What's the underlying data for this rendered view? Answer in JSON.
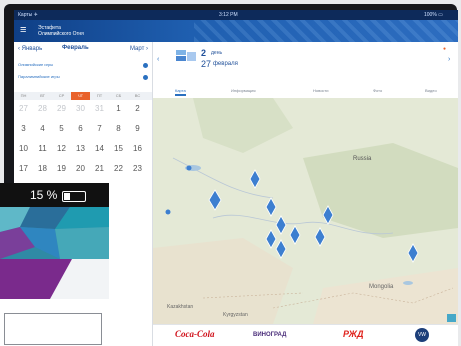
{
  "statusbar": {
    "carrier": "Карты ✈",
    "time": "3:12 PM",
    "battery": "100% ▭"
  },
  "app": {
    "title_line1": "Эстафета",
    "title_line2": "Олимпийского Огня"
  },
  "calendar": {
    "prev": "‹ Январь",
    "month": "Февраль",
    "next": "Март ›",
    "filter1": "Олимпийские игры",
    "filter2": "Паралимпийские игры",
    "weekdays": [
      "ПН",
      "ВТ",
      "СР",
      "ЧТ",
      "ПТ",
      "СБ",
      "ВС"
    ],
    "rows": [
      [
        "27",
        "28",
        "29",
        "30",
        "31",
        "1",
        "2"
      ],
      [
        "3",
        "4",
        "5",
        "6",
        "7",
        "8",
        "9"
      ],
      [
        "10",
        "11",
        "12",
        "13",
        "14",
        "15",
        "16"
      ],
      [
        "17",
        "18",
        "19",
        "20",
        "21",
        "22",
        "23"
      ]
    ]
  },
  "main": {
    "day_number": "2",
    "day_word": "день",
    "date_number": "27",
    "date_month": "февраля",
    "tabs": [
      "Карта",
      "Информация",
      "Новости",
      "Фото",
      "Видео"
    ]
  },
  "map": {
    "labels": [
      "Russia",
      "Kazakhstan",
      "Mongolia",
      "Kyrgyzstan"
    ]
  },
  "sponsors": [
    "Coca-Cola",
    "ВИНОГРАД",
    "РЖД",
    "VW"
  ],
  "phone": {
    "battery_text": "15 %"
  },
  "colors": {
    "accent": "#e9622b",
    "brand": "#1f4f99",
    "link": "#2a70c0",
    "purple": "#7a2a8c"
  }
}
